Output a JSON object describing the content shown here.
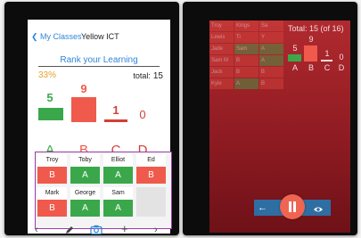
{
  "left": {
    "nav": {
      "back_label": "My Classes",
      "title": "Yellow ICT"
    },
    "rank_title": "Rank your Learning",
    "percent": "33%",
    "total_label": "total:",
    "total_value": "15",
    "grades": [
      {
        "letter": "A",
        "count": "5",
        "color": "#3aa84a"
      },
      {
        "letter": "B",
        "count": "9",
        "color": "#ef5a4c"
      },
      {
        "letter": "C",
        "count": "1",
        "color": "#d43f32"
      },
      {
        "letter": "D",
        "count": "0",
        "color": "#d43f32"
      }
    ],
    "students": [
      {
        "name": "Troy",
        "grade": "B"
      },
      {
        "name": "Toby",
        "grade": "A"
      },
      {
        "name": "Elliot",
        "grade": "A"
      },
      {
        "name": "Ed",
        "grade": "B"
      },
      {
        "name": "Mark",
        "grade": "B"
      },
      {
        "name": "George",
        "grade": "A"
      },
      {
        "name": "Sam",
        "grade": "A"
      }
    ],
    "toolbar": {
      "prev": "‹",
      "plus": "+",
      "next": "›"
    },
    "colors": {
      "grade_a": "#3aa84a",
      "grade_b": "#ef5a4c",
      "accent": "#2f86d8",
      "percent": "#e2a12c"
    }
  },
  "right": {
    "total_text": "Total: 15 (of 16)",
    "grades": [
      {
        "letter": "A",
        "count": "5"
      },
      {
        "letter": "B",
        "count": "9"
      },
      {
        "letter": "C",
        "count": "1"
      },
      {
        "letter": "D",
        "count": "0"
      }
    ],
    "dim_rows": [
      [
        "Troy",
        "Kings",
        "Sa"
      ],
      [
        "Lewis",
        "Ti",
        "Y"
      ],
      [
        "Jade",
        "Sam",
        "A"
      ],
      [
        "Sam M",
        "B",
        "A"
      ],
      [
        "Jack",
        "B",
        "B"
      ],
      [
        "Kyle",
        "A",
        "B"
      ]
    ],
    "controls": {
      "back": "←"
    }
  }
}
